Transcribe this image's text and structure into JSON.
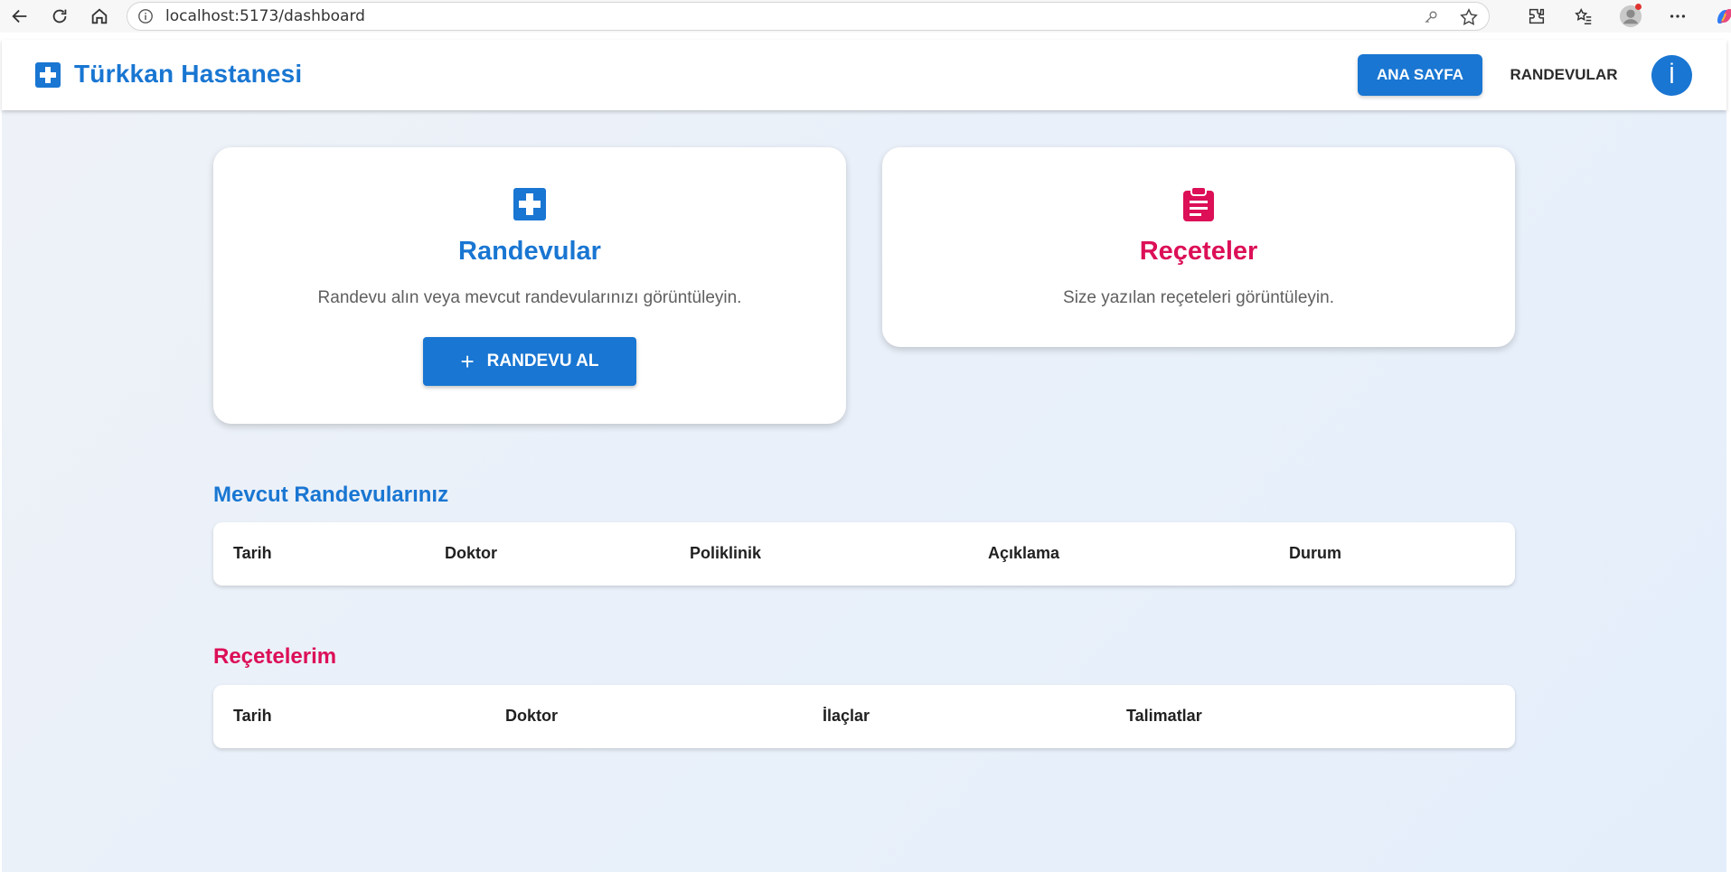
{
  "browser": {
    "url": "localhost:5173/dashboard",
    "icons": [
      "back-arrow-icon",
      "reload-icon",
      "home-icon",
      "info-icon",
      "key-icon",
      "star-icon",
      "extensions-icon",
      "favorites-icon",
      "profile-icon",
      "more-icon",
      "copilot-icon"
    ]
  },
  "header": {
    "brand": "Türkkan Hastanesi",
    "nav_home": "ANA SAYFA",
    "nav_appointments": "RANDEVULAR",
    "avatar_letter": "İ"
  },
  "cards": {
    "appointments": {
      "title": "Randevular",
      "description": "Randevu alın veya mevcut randevularınızı görüntüleyin.",
      "button_label": "RANDEVU AL",
      "button_icon": "+"
    },
    "prescriptions": {
      "title": "Reçeteler",
      "description": "Size yazılan reçeteleri görüntüleyin."
    }
  },
  "appointments_section": {
    "title": "Mevcut Randevularınız",
    "columns": [
      "Tarih",
      "Doktor",
      "Poliklinik",
      "Açıklama",
      "Durum"
    ]
  },
  "prescriptions_section": {
    "title": "Reçetelerim",
    "columns": [
      "Tarih",
      "Doktor",
      "İlaçlar",
      "Talimatlar"
    ]
  },
  "colors": {
    "primary": "#1976d2",
    "accent": "#dc0f57"
  }
}
